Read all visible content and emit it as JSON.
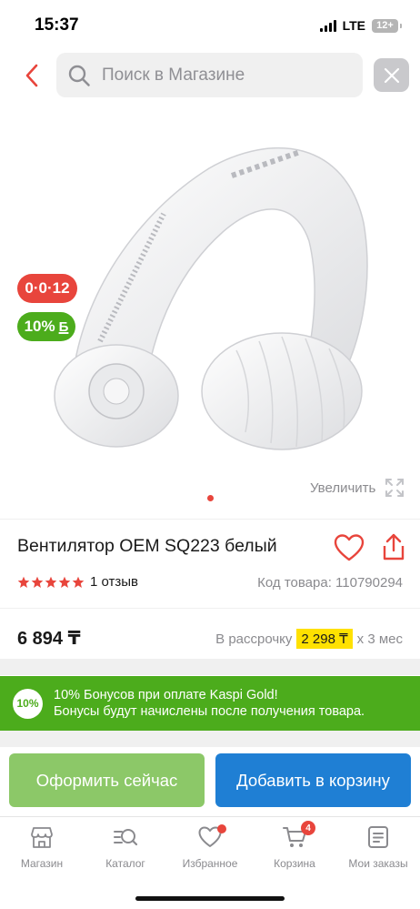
{
  "status_bar": {
    "time": "15:37",
    "network": "LTE",
    "battery": "12+"
  },
  "search": {
    "placeholder": "Поиск в Магазине"
  },
  "badges": {
    "installment": "0·0·12",
    "bonus_percent": "10%",
    "bonus_symbol": "Б"
  },
  "gallery": {
    "zoom_label": "Увеличить"
  },
  "product": {
    "title": "Вентилятор OEM SQ223 белый",
    "rating": 5,
    "reviews": "1 отзыв",
    "code": "Код товара: 110790294",
    "price": "6 894 ₸",
    "installment_prefix": "В рассрочку",
    "installment_amount": "2 298 ₸",
    "installment_suffix": "х 3 мес"
  },
  "bonus_banner": {
    "circle": "10%",
    "line1": "10% Бонусов при оплате Kaspi Gold!",
    "line2": "Бонусы будут начислены после получения товара."
  },
  "buttons": {
    "checkout": "Оформить сейчас",
    "add_to_cart": "Добавить в корзину"
  },
  "tabs": [
    {
      "label": "Магазин",
      "icon": "store-icon"
    },
    {
      "label": "Каталог",
      "icon": "catalog-search-icon"
    },
    {
      "label": "Избранное",
      "icon": "heart-icon"
    },
    {
      "label": "Корзина",
      "icon": "cart-icon",
      "badge": "4"
    },
    {
      "label": "Мои заказы",
      "icon": "orders-icon"
    }
  ],
  "colors": {
    "accent_red": "#e8453c",
    "bonus_green": "#4cac1c",
    "primary_blue": "#1f7fd4",
    "checkout_green": "#8cc868",
    "highlight_yellow": "#ffe100"
  }
}
